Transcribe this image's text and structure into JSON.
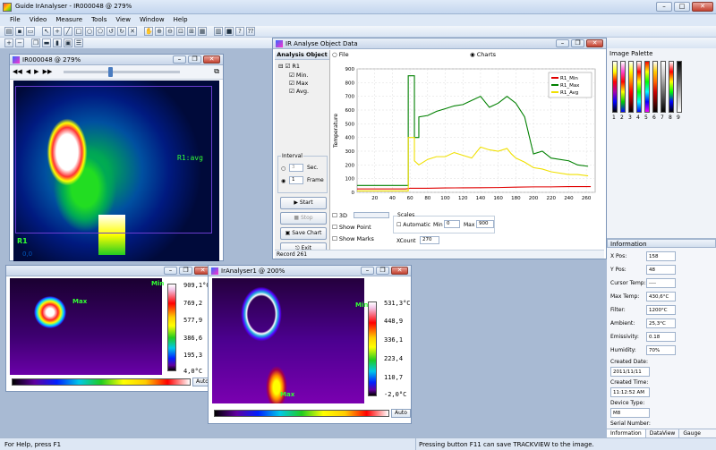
{
  "app": {
    "title": "Guide IrAnalyser - IR000048 @ 279%"
  },
  "menu": [
    "File",
    "Video",
    "Measure",
    "Tools",
    "View",
    "Window",
    "Help"
  ],
  "win1": {
    "title": "IR000048 @ 279%",
    "transport": [
      "◀◀",
      "◀",
      "▶",
      "▶▶"
    ],
    "overlay_label": "R1:avg",
    "roi_label": "R1",
    "value_label": "0,0"
  },
  "win2": {
    "marker_min": "Min",
    "marker_max": "Max",
    "scale": [
      "909,1°C",
      "769,2",
      "577,9",
      "386,6",
      "195,3",
      "4,0°C"
    ],
    "auto": "Auto"
  },
  "win3": {
    "title": "IrAnalyser1 @ 200%",
    "marker_min": "Min",
    "marker_max": "Max",
    "scale": [
      "531,3°C",
      "448,9",
      "336,1",
      "223,4",
      "110,7",
      "-2,0°C"
    ],
    "auto": "Auto"
  },
  "analysis": {
    "title": "IR Analyse Object Data",
    "tab_file": "File",
    "tab_charts": "Charts",
    "object_header": "Analysis Object",
    "tree_root": "R1",
    "tree_children": [
      "Min.",
      "Max",
      "Avg."
    ],
    "interval_label": "Interval",
    "sec_value": "3",
    "sec_label": "Sec.",
    "frame_value": "1",
    "frame_label": "Frame",
    "btn_start": "Start",
    "btn_stop": "Stop",
    "btn_save": "Save Chart",
    "btn_exit": "Exit",
    "opt_3d": "3D",
    "opt_show_point": "Show Point",
    "opt_show_marks": "Show Marks",
    "scales_label": "Scales",
    "automatic_label": "Automatic",
    "min_label": "Min",
    "min_value": "0",
    "max_label": "Max",
    "max_value": "900",
    "xcount_label": "XCount",
    "xcount_value": "270",
    "record_label": "Record 261"
  },
  "chart_data": {
    "type": "line",
    "ylabel": "Temperature",
    "xlim": [
      0,
      270
    ],
    "ylim": [
      0,
      900
    ],
    "xticks": [
      20,
      40,
      60,
      80,
      100,
      120,
      140,
      160,
      180,
      200,
      220,
      240,
      260
    ],
    "yticks": [
      0,
      100,
      200,
      300,
      400,
      500,
      600,
      700,
      800,
      900
    ],
    "grid": true,
    "legend": "top-right",
    "series": [
      {
        "name": "R1_Min",
        "color": "#e00000",
        "x": [
          0,
          55,
          60,
          80,
          100,
          120,
          140,
          160,
          180,
          200,
          220,
          240,
          260,
          265
        ],
        "y": [
          25,
          25,
          30,
          30,
          32,
          33,
          34,
          35,
          38,
          40,
          40,
          42,
          42,
          42
        ]
      },
      {
        "name": "R1_Max",
        "color": "#008000",
        "x": [
          0,
          55,
          58,
          58,
          65,
          65,
          70,
          70,
          80,
          90,
          100,
          110,
          120,
          130,
          140,
          150,
          160,
          170,
          180,
          190,
          200,
          210,
          220,
          240,
          250,
          262
        ],
        "y": [
          50,
          50,
          50,
          850,
          850,
          400,
          400,
          550,
          560,
          590,
          610,
          630,
          640,
          670,
          700,
          620,
          650,
          700,
          650,
          550,
          280,
          300,
          250,
          230,
          200,
          190
        ]
      },
      {
        "name": "R1_Avg",
        "color": "#f0e000",
        "x": [
          0,
          55,
          58,
          58,
          65,
          65,
          70,
          80,
          90,
          100,
          110,
          120,
          130,
          140,
          150,
          160,
          170,
          175,
          180,
          190,
          200,
          210,
          220,
          240,
          250,
          262
        ],
        "y": [
          10,
          10,
          10,
          400,
          400,
          230,
          200,
          240,
          260,
          260,
          290,
          270,
          250,
          330,
          310,
          300,
          320,
          280,
          250,
          220,
          180,
          170,
          150,
          130,
          130,
          120
        ]
      }
    ]
  },
  "palette": {
    "title": "Image Palette",
    "labels": [
      "1",
      "2",
      "3",
      "4",
      "5",
      "6",
      "7",
      "8",
      "9"
    ]
  },
  "info": {
    "title": "Information",
    "rows": [
      {
        "label": "X Pos:",
        "value": "158"
      },
      {
        "label": "Y Pos:",
        "value": "48"
      },
      {
        "label": "Cursor Temp:",
        "value": "----"
      },
      {
        "label": "Max Temp:",
        "value": "430,6°C"
      },
      {
        "label": "Filter:",
        "value": "1200°C"
      },
      {
        "label": "Ambient:",
        "value": "25,3°C"
      },
      {
        "label": "Emissivity:",
        "value": "0.18"
      },
      {
        "label": "Humidity:",
        "value": "70%"
      }
    ],
    "created_date_label": "Created Date:",
    "created_date": "2011/11/11",
    "created_time_label": "Created Time:",
    "created_time": "11:12:52 AM",
    "device_type_label": "Device Type:",
    "device_type": "M8",
    "serial_label": "Serial Number:",
    "serial": "",
    "tabs": [
      "Information",
      "DataView",
      "Gauge"
    ]
  },
  "status": {
    "left": "For Help, press F1",
    "right": "Pressing button F11 can save TRACKVIEW to the image."
  }
}
